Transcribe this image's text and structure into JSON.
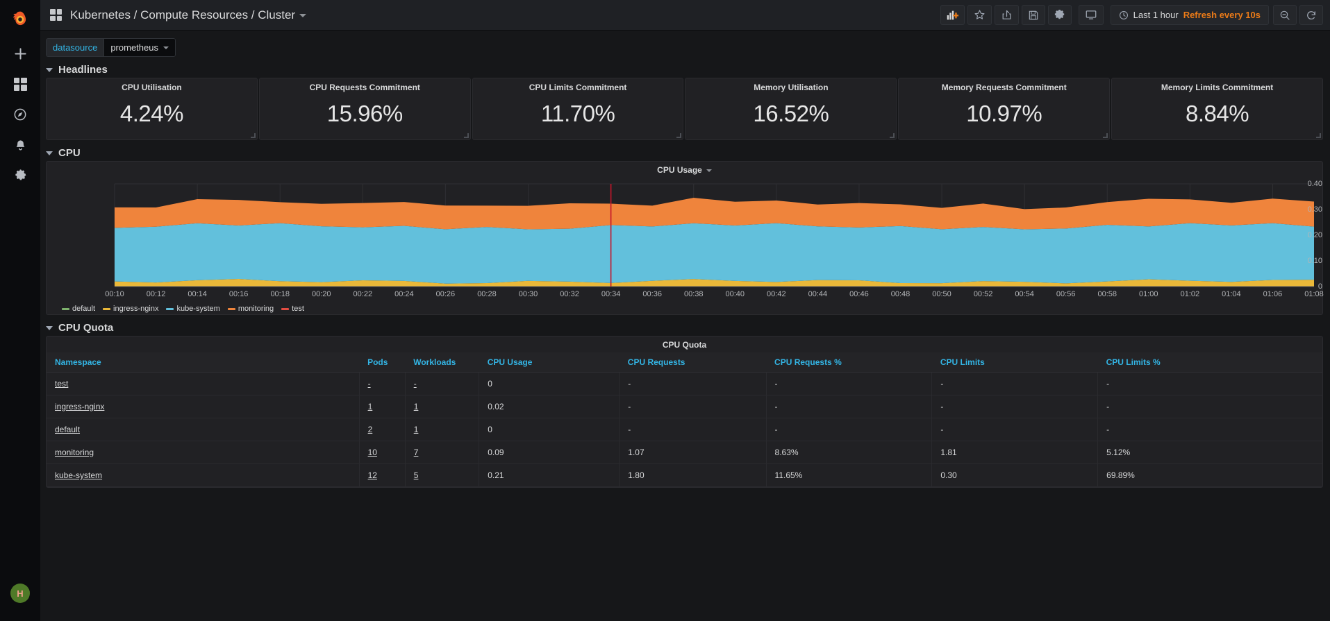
{
  "sidebar": {
    "logo": "grafana-logo",
    "items": [
      {
        "name": "create-icon",
        "label": "Create"
      },
      {
        "name": "dashboards-icon",
        "label": "Dashboards"
      },
      {
        "name": "explore-icon",
        "label": "Explore"
      },
      {
        "name": "alerting-icon",
        "label": "Alerting"
      },
      {
        "name": "configuration-icon",
        "label": "Configuration"
      }
    ],
    "avatar_initial": "H"
  },
  "topbar": {
    "title_parts": [
      "Kubernetes",
      "Compute Resources",
      "Cluster"
    ],
    "title_full": "Kubernetes / Compute Resources / Cluster",
    "buttons": [
      {
        "name": "add-panel-button",
        "label": "Add panel"
      },
      {
        "name": "star-button",
        "label": "Mark as favorite"
      },
      {
        "name": "share-button",
        "label": "Share dashboard"
      },
      {
        "name": "save-button",
        "label": "Save dashboard"
      },
      {
        "name": "settings-button",
        "label": "Dashboard settings"
      },
      {
        "name": "tv-mode-button",
        "label": "Cycle view mode"
      }
    ],
    "time_range": "Last 1 hour",
    "refresh_interval": "Refresh every 10s",
    "zoom_out_label": "Zoom out time range",
    "refresh_label": "Refresh dashboard"
  },
  "variables": [
    {
      "label": "datasource",
      "value": "prometheus"
    }
  ],
  "rows": [
    {
      "title": "Headlines",
      "collapsed": false
    },
    {
      "title": "CPU",
      "collapsed": false
    },
    {
      "title": "CPU Quota",
      "collapsed": false
    }
  ],
  "headlines": [
    {
      "title": "CPU Utilisation",
      "value": "4.24%"
    },
    {
      "title": "CPU Requests Commitment",
      "value": "15.96%"
    },
    {
      "title": "CPU Limits Commitment",
      "value": "11.70%"
    },
    {
      "title": "Memory Utilisation",
      "value": "16.52%"
    },
    {
      "title": "Memory Requests Commitment",
      "value": "10.97%"
    },
    {
      "title": "Memory Limits Commitment",
      "value": "8.84%"
    }
  ],
  "chart_data": {
    "type": "area",
    "title": "CPU Usage",
    "stacked": true,
    "xlabel": "",
    "ylabel": "",
    "ylim": [
      0,
      0.4
    ],
    "yticks": [
      "0",
      "0.10",
      "0.20",
      "0.30",
      "0.40"
    ],
    "grid": true,
    "legend_position": "bottom",
    "annotation_line": {
      "x": "00:34",
      "color": "#c4162a"
    },
    "x": [
      "00:10",
      "00:12",
      "00:14",
      "00:16",
      "00:18",
      "00:20",
      "00:22",
      "00:24",
      "00:26",
      "00:28",
      "00:30",
      "00:32",
      "00:34",
      "00:36",
      "00:38",
      "00:40",
      "00:42",
      "00:44",
      "00:46",
      "00:48",
      "00:50",
      "00:52",
      "00:54",
      "00:56",
      "00:58",
      "01:00",
      "01:02",
      "01:04",
      "01:06",
      "01:08"
    ],
    "series": [
      {
        "name": "default",
        "color": "#7eb26d",
        "values": [
          0,
          0,
          0,
          0,
          0,
          0,
          0,
          0,
          0,
          0,
          0,
          0,
          0,
          0,
          0,
          0,
          0,
          0,
          0,
          0,
          0,
          0,
          0,
          0,
          0,
          0,
          0,
          0,
          0,
          0
        ]
      },
      {
        "name": "ingress-nginx",
        "color": "#eab839",
        "values": [
          0.02,
          0.02,
          0.02,
          0.02,
          0.02,
          0.02,
          0.02,
          0.02,
          0.02,
          0.02,
          0.02,
          0.02,
          0.02,
          0.02,
          0.02,
          0.02,
          0.02,
          0.02,
          0.02,
          0.02,
          0.02,
          0.02,
          0.02,
          0.02,
          0.02,
          0.02,
          0.02,
          0.02,
          0.02,
          0.02
        ]
      },
      {
        "name": "kube-system",
        "color": "#62c0dc",
        "values": [
          0.21,
          0.21,
          0.22,
          0.21,
          0.22,
          0.21,
          0.21,
          0.22,
          0.21,
          0.22,
          0.21,
          0.21,
          0.22,
          0.21,
          0.22,
          0.21,
          0.22,
          0.21,
          0.21,
          0.22,
          0.21,
          0.22,
          0.21,
          0.21,
          0.22,
          0.21,
          0.22,
          0.21,
          0.22,
          0.21
        ]
      },
      {
        "name": "monitoring",
        "color": "#ef843c",
        "values": [
          0.08,
          0.08,
          0.09,
          0.09,
          0.08,
          0.09,
          0.09,
          0.09,
          0.1,
          0.09,
          0.09,
          0.1,
          0.09,
          0.08,
          0.09,
          0.09,
          0.09,
          0.08,
          0.09,
          0.09,
          0.09,
          0.09,
          0.08,
          0.09,
          0.09,
          0.1,
          0.09,
          0.09,
          0.09,
          0.09
        ]
      },
      {
        "name": "test",
        "color": "#e24d42",
        "values": [
          0,
          0,
          0,
          0,
          0,
          0,
          0,
          0,
          0,
          0,
          0,
          0,
          0,
          0,
          0,
          0,
          0,
          0,
          0,
          0,
          0,
          0,
          0,
          0,
          0,
          0,
          0,
          0,
          0,
          0
        ]
      }
    ]
  },
  "table": {
    "title": "CPU Quota",
    "columns": [
      "Namespace",
      "Pods",
      "Workloads",
      "CPU Usage",
      "CPU Requests",
      "CPU Requests %",
      "CPU Limits",
      "CPU Limits %"
    ],
    "rows": [
      {
        "namespace": "test",
        "pods": "-",
        "workloads": "-",
        "cpu_usage": "0",
        "cpu_requests": "-",
        "cpu_requests_pct": "-",
        "cpu_limits": "-",
        "cpu_limits_pct": "-"
      },
      {
        "namespace": "ingress-nginx",
        "pods": "1",
        "workloads": "1",
        "cpu_usage": "0.02",
        "cpu_requests": "-",
        "cpu_requests_pct": "-",
        "cpu_limits": "-",
        "cpu_limits_pct": "-"
      },
      {
        "namespace": "default",
        "pods": "2",
        "workloads": "1",
        "cpu_usage": "0",
        "cpu_requests": "-",
        "cpu_requests_pct": "-",
        "cpu_limits": "-",
        "cpu_limits_pct": "-"
      },
      {
        "namespace": "monitoring",
        "pods": "10",
        "workloads": "7",
        "cpu_usage": "0.09",
        "cpu_requests": "1.07",
        "cpu_requests_pct": "8.63%",
        "cpu_limits": "1.81",
        "cpu_limits_pct": "5.12%"
      },
      {
        "namespace": "kube-system",
        "pods": "12",
        "workloads": "5",
        "cpu_usage": "0.21",
        "cpu_requests": "1.80",
        "cpu_requests_pct": "11.65%",
        "cpu_limits": "0.30",
        "cpu_limits_pct": "69.89%"
      }
    ]
  }
}
